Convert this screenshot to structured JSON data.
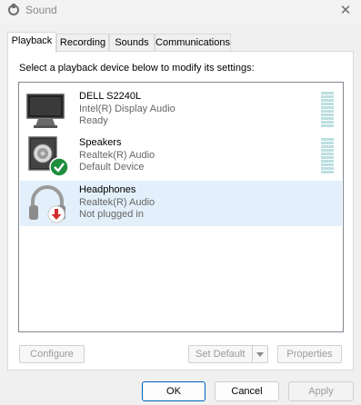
{
  "window": {
    "title": "Sound",
    "close_glyph": "✕"
  },
  "tabs": [
    "Playback",
    "Recording",
    "Sounds",
    "Communications"
  ],
  "instruction": "Select a playback device below to modify its settings:",
  "devices": [
    {
      "name": "DELL S2240L",
      "driver": "Intel(R) Display Audio",
      "status": "Ready",
      "icon": "monitor-icon",
      "badge": "",
      "meter_level": 0.0
    },
    {
      "name": "Speakers",
      "driver": "Realtek(R) Audio",
      "status": "Default Device",
      "icon": "speaker-icon",
      "badge": "default-check-icon",
      "meter_level": 0.0
    },
    {
      "name": "Headphones",
      "driver": "Realtek(R) Audio",
      "status": "Not plugged in",
      "icon": "headphones-icon",
      "badge": "unplugged-arrow-icon",
      "selected": true
    }
  ],
  "buttons": {
    "configure": "Configure",
    "set_default": "Set Default",
    "properties": "Properties",
    "ok": "OK",
    "cancel": "Cancel",
    "apply": "Apply"
  },
  "colors": {
    "selection": "#e3f0fb",
    "meter": "#bddfe0",
    "default_badge": "#1e8e3e",
    "unplugged_badge": "#d32f2f"
  }
}
